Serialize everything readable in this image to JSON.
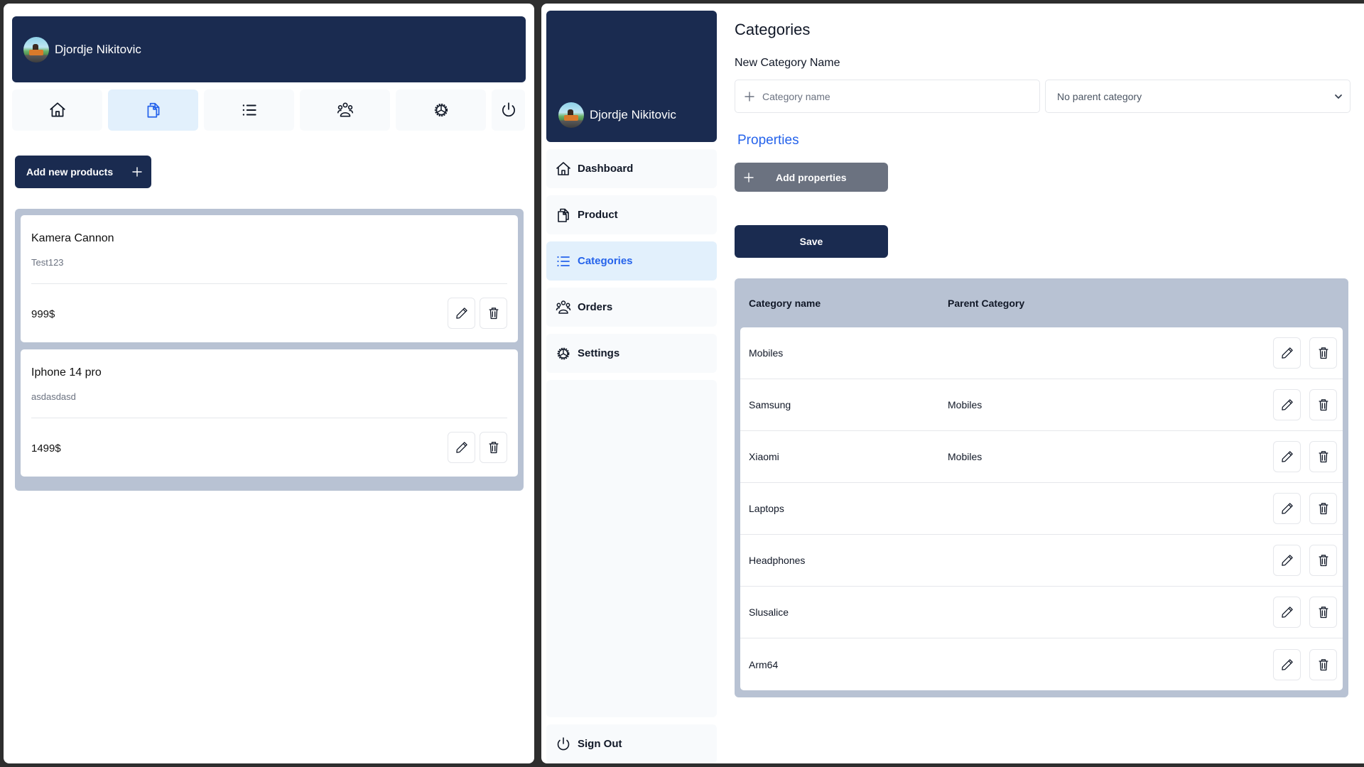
{
  "user": {
    "name": "Djordje Nikitovic"
  },
  "left_window": {
    "icon_nav": [
      {
        "icon": "home-icon",
        "label": "Dashboard",
        "active": false
      },
      {
        "icon": "documents-icon",
        "label": "Product",
        "active": true
      },
      {
        "icon": "list-icon",
        "label": "Categories",
        "active": false
      },
      {
        "icon": "users-icon",
        "label": "Orders",
        "active": false
      },
      {
        "icon": "gear-icon",
        "label": "Settings",
        "active": false
      },
      {
        "icon": "power-icon",
        "label": "Sign Out",
        "active": false
      }
    ],
    "add_button_label": "Add new products",
    "products": [
      {
        "name": "Kamera Cannon",
        "description": "Test123",
        "price": "999$"
      },
      {
        "name": "Iphone 14 pro",
        "description": "asdasdasd",
        "price": "1499$"
      }
    ]
  },
  "right_window": {
    "sidebar": {
      "items": [
        {
          "label": "Dashboard",
          "icon": "home-icon",
          "active": false
        },
        {
          "label": "Product",
          "icon": "documents-icon",
          "active": false
        },
        {
          "label": "Categories",
          "icon": "list-icon",
          "active": true
        },
        {
          "label": "Orders",
          "icon": "users-icon",
          "active": false
        },
        {
          "label": "Settings",
          "icon": "gear-icon",
          "active": false
        }
      ],
      "sign_out_label": "Sign Out"
    },
    "page_title": "Categories",
    "form": {
      "label": "New Category Name",
      "name_input": {
        "placeholder": "Category name",
        "value": ""
      },
      "parent_select": {
        "selected": "No parent category"
      },
      "properties_title": "Properties",
      "add_properties_label": "Add properties",
      "save_label": "Save"
    },
    "table": {
      "columns": [
        "Category name",
        "Parent Category"
      ],
      "rows": [
        {
          "name": "Mobiles",
          "parent": ""
        },
        {
          "name": "Samsung",
          "parent": "Mobiles"
        },
        {
          "name": "Xiaomi",
          "parent": "Mobiles"
        },
        {
          "name": "Laptops",
          "parent": ""
        },
        {
          "name": "Headphones",
          "parent": ""
        },
        {
          "name": "Slusalice",
          "parent": ""
        },
        {
          "name": "Arm64",
          "parent": ""
        }
      ]
    }
  },
  "colors": {
    "primary_navy": "#1a2b50",
    "accent_blue": "#2563eb",
    "active_bg": "#e2f0fc",
    "panel_gray": "#b8c2d3",
    "secondary_button": "#6b7280"
  }
}
